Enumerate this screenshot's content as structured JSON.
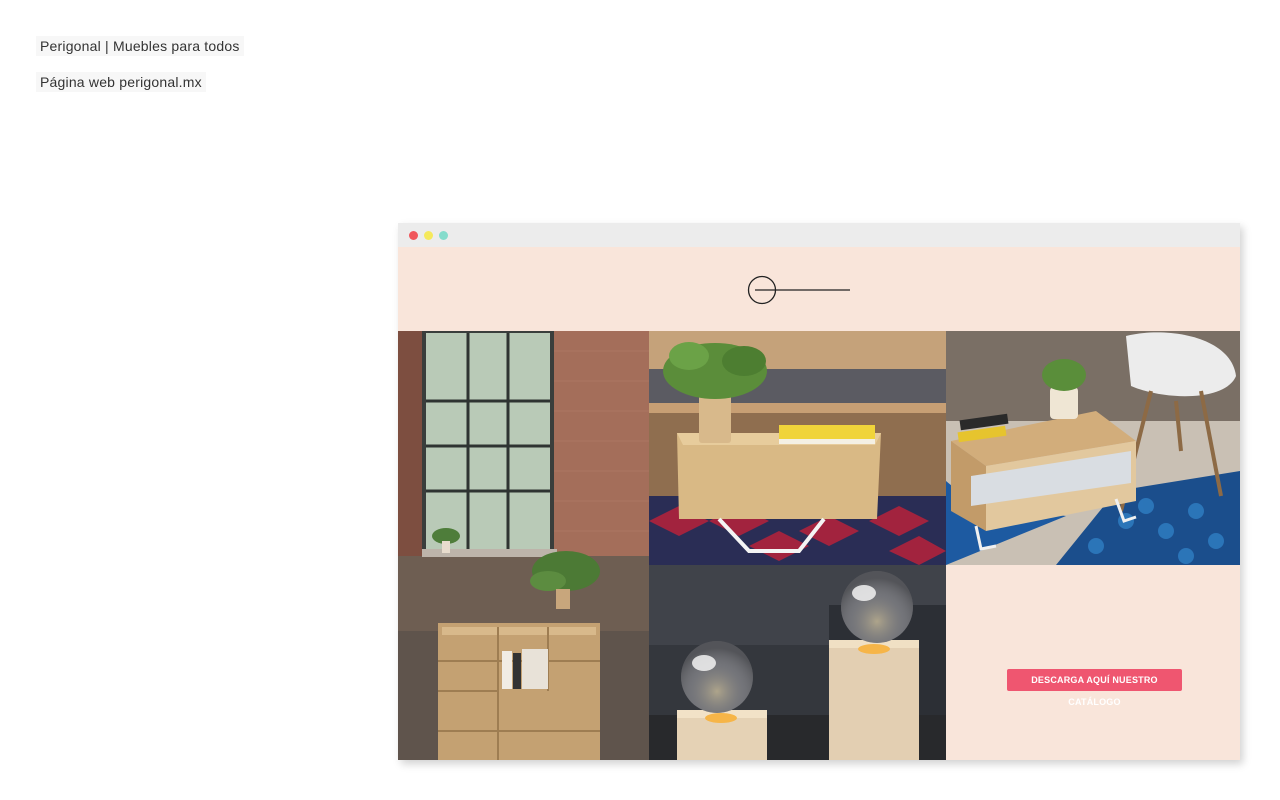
{
  "project": {
    "title": "Perigonal | Muebles para todos",
    "subtitle": "Página web perigonal.mx"
  },
  "browser": {
    "buttons": [
      "close-dot",
      "minimize-dot",
      "maximize-dot"
    ],
    "colors": {
      "close": "#f0575c",
      "minimize": "#f5e95c",
      "maximize": "#85dccc",
      "background": "#f9e5da"
    }
  },
  "site": {
    "logo_icon": "circle-line-logo",
    "tiles": [
      {
        "name": "shelf-window-photo"
      },
      {
        "name": "coffee-table-photo"
      },
      {
        "name": "side-table-drawer-photo"
      },
      {
        "name": "wood-lamps-photo"
      }
    ],
    "cta_label": "DESCARGA AQUÍ NUESTRO CATÁLOGO",
    "cta_color": "#ef5670"
  }
}
